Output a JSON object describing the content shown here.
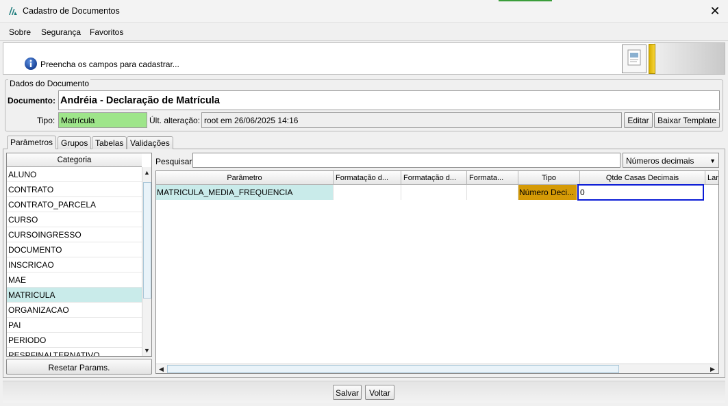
{
  "window": {
    "title": "Cadastro de Documentos",
    "close_glyph": "✕"
  },
  "menu": {
    "items": [
      "Sobre",
      "Segurança",
      "Favoritos"
    ]
  },
  "banner": {
    "message": "Preencha os campos para cadastrar..."
  },
  "dados": {
    "legend": "Dados do Documento",
    "documento_label": "Documento:",
    "documento_value": "Andréia - Declaração de Matrícula",
    "tipo_label": "Tipo:",
    "tipo_value": "Matrícula",
    "alteracao_label": "Últ. alteração:",
    "alteracao_value": "root em 26/06/2025 14:16",
    "editar_label": "Editar",
    "baixar_label": "Baixar Template"
  },
  "tabs": [
    "Parâmetros",
    "Grupos",
    "Tabelas",
    "Validações"
  ],
  "categorias": {
    "header": "Categoria",
    "items": [
      "ALUNO",
      "CONTRATO",
      "CONTRATO_PARCELA",
      "CURSO",
      "CURSOINGRESSO",
      "DOCUMENTO",
      "INSCRICAO",
      "MAE",
      "MATRICULA",
      "ORGANIZACAO",
      "PAI",
      "PERIODO",
      "RESPFINALTERNATIVO"
    ],
    "selected": "MATRICULA",
    "reset_label": "Resetar Params."
  },
  "search": {
    "label": "Pesquisar:",
    "value": ""
  },
  "filter": {
    "selected": "Números decimais"
  },
  "grid": {
    "headers": [
      "Parâmetro",
      "Formatação d...",
      "Formatação d...",
      "Formata...",
      "Tipo",
      "Qtde Casas Decimais",
      "Larg"
    ],
    "rows": [
      {
        "parametro": "MATRICULA_MEDIA_FREQUENCIA",
        "fmt1": "",
        "fmt2": "",
        "fmt3": "",
        "tipo": "Número Deci...",
        "casas": "0"
      }
    ]
  },
  "footer": {
    "salvar": "Salvar",
    "voltar": "Voltar"
  },
  "colors": {
    "tipo_ok": "#9ee58a",
    "selected_row": "#c9ebea",
    "tipo_cell": "#d59a06",
    "edit_border": "#0a1bd6"
  }
}
